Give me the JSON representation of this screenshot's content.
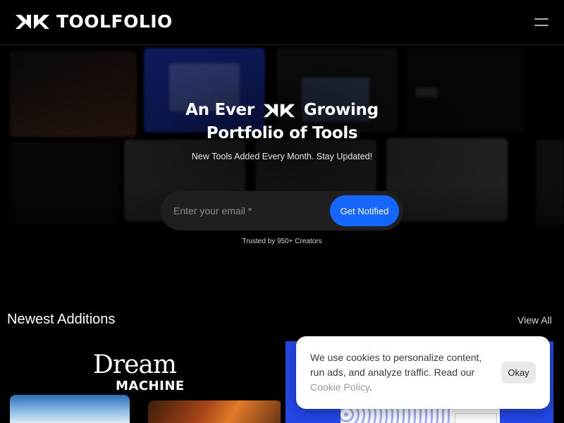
{
  "header": {
    "brand": "TOOLFOLIO",
    "logo_icon": "toolfolio-arrows-icon",
    "menu_icon": "hamburger-menu-icon"
  },
  "hero": {
    "title_part1": "An Ever",
    "title_part2": "Growing",
    "title_line2": "Portfolio of Tools",
    "subtitle": "New Tools Added Every Month. Stay Updated!",
    "email_placeholder": "Enter your email *",
    "email_value": "",
    "cta_label": "Get Notified",
    "trusted": "Trusted by 950+ Creators",
    "colors": {
      "cta": "#1466ff",
      "input_bg": "#1f1f1f"
    }
  },
  "newest": {
    "title": "Newest Additions",
    "view_all": "View All",
    "cards": [
      {
        "title_line1": "Dream",
        "title_line2": "MACHINE",
        "background": "#000000"
      },
      {
        "background": "#2448e8"
      }
    ]
  },
  "cookie_banner": {
    "text": "We use cookies to personalize content, run ads, and analyze traffic. Read our",
    "link_label": "Cookie Policy",
    "suffix": ".",
    "button_label": "Okay"
  }
}
